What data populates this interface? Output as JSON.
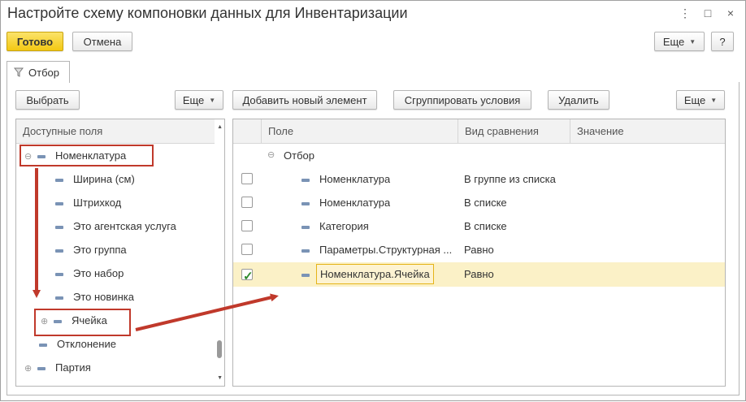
{
  "window": {
    "title": "Настройте схему компоновки данных для Инвентаризации",
    "controls": [
      "⋮",
      "□",
      "×"
    ]
  },
  "toolbar": {
    "done_label": "Готово",
    "cancel_label": "Отмена",
    "more_label": "Еще",
    "help_label": "?"
  },
  "tab": {
    "label": "Отбор"
  },
  "left_toolbar": {
    "select_label": "Выбрать",
    "more_label": "Еще"
  },
  "right_toolbar": {
    "add_label": "Добавить новый элемент",
    "group_label": "Сгруппировать условия",
    "delete_label": "Удалить",
    "more_label": "Еще"
  },
  "tree": {
    "header": "Доступные поля",
    "items": [
      {
        "label": "Номенклатура",
        "expander": "⊖",
        "level": 0
      },
      {
        "label": "Ширина (см)",
        "expander": "",
        "level": 1
      },
      {
        "label": "Штрихкод",
        "expander": "",
        "level": 1
      },
      {
        "label": "Это агентская услуга",
        "expander": "",
        "level": 1
      },
      {
        "label": "Это группа",
        "expander": "",
        "level": 1
      },
      {
        "label": "Это набор",
        "expander": "",
        "level": 1
      },
      {
        "label": "Это новинка",
        "expander": "",
        "level": 1
      },
      {
        "label": "Ячейка",
        "expander": "⊕",
        "level": 1
      },
      {
        "label": "Отклонение",
        "expander": "",
        "level": 0
      },
      {
        "label": "Партия",
        "expander": "⊕",
        "level": 0
      }
    ]
  },
  "grid": {
    "columns": [
      "Поле",
      "Вид сравнения",
      "Значение"
    ],
    "group_row": {
      "label": "Отбор",
      "expander": "⊖"
    },
    "rows": [
      {
        "field": "Номенклатура",
        "comparison": "В группе из списка",
        "value": "",
        "checked": false
      },
      {
        "field": "Номенклатура",
        "comparison": "В списке",
        "value": "",
        "checked": false
      },
      {
        "field": "Категория",
        "comparison": "В списке",
        "value": "",
        "checked": false
      },
      {
        "field": "Параметры.Структурная ...",
        "comparison": "Равно",
        "value": "",
        "checked": false
      },
      {
        "field": "Номенклатура.Ячейка",
        "comparison": "Равно",
        "value": "",
        "checked": true
      }
    ]
  },
  "colors": {
    "accent_yellow": "#f3c813",
    "annotation_red": "#c0392b",
    "selected_row": "#fbf1c7"
  }
}
